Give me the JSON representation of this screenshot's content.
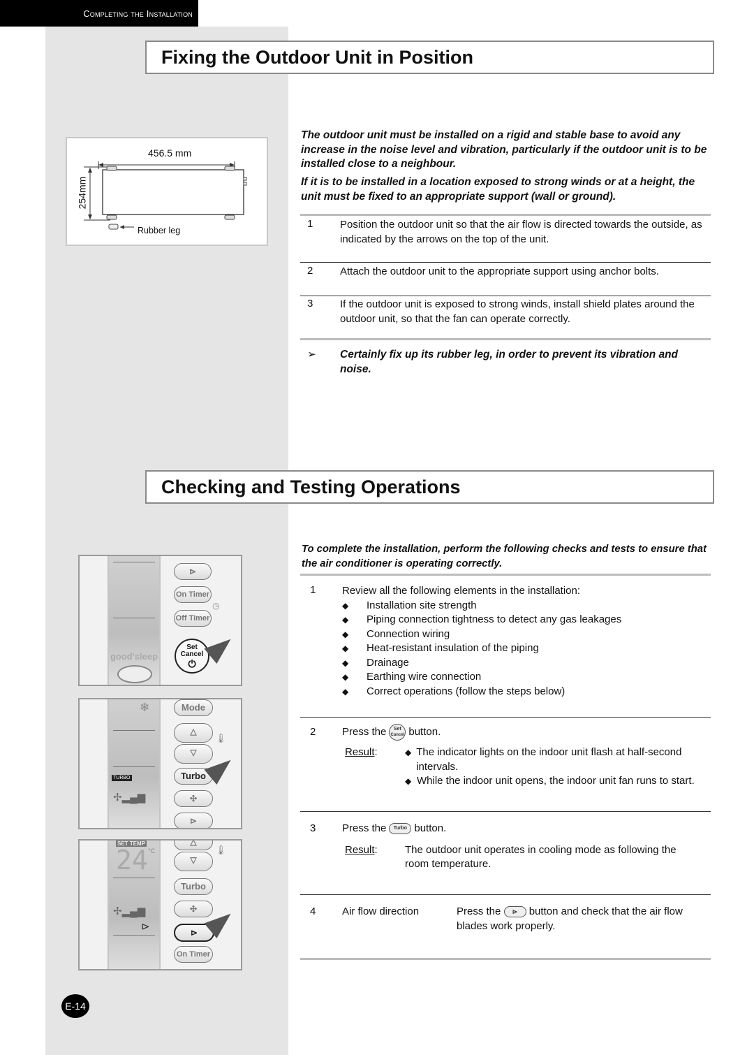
{
  "header": {
    "section": "Completing the Installation"
  },
  "section1": {
    "title": "Fixing the Outdoor Unit in Position",
    "diagram": {
      "width_label": "456.5 mm",
      "height_label": "254mm",
      "rubber_leg_label": "Rubber leg"
    },
    "intro_1": "The outdoor unit must be installed on a rigid and stable base to avoid any increase in the noise level and vibration, particularly if the outdoor unit is to be installed close to a neighbour.",
    "intro_2": "If it is to be installed in a location exposed to strong winds or at a height, the unit must be fixed to an appropriate support (wall or ground).",
    "steps": [
      {
        "num": "1",
        "text": "Position the outdoor unit so that the air flow is directed towards the outside, as indicated by the arrows on the top of the unit."
      },
      {
        "num": "2",
        "text": "Attach the outdoor unit to the appropriate support using anchor bolts."
      },
      {
        "num": "3",
        "text": "If the outdoor unit is exposed to strong winds, install shield plates around the outdoor unit, so that the fan can operate correctly."
      }
    ],
    "note_icon": "➢",
    "note": "Certainly fix up its rubber leg, in order to prevent its vibration and noise."
  },
  "section2": {
    "title": "Checking and Testing Operations",
    "intro": "To complete the installation, perform the following checks and tests to ensure that the air conditioner is operating correctly.",
    "step1": {
      "num": "1",
      "text": "Review all the following elements in the installation:",
      "bullet": "◆",
      "items": [
        "Installation site strength",
        "Piping connection tightness to detect any gas leakages",
        "Connection wiring",
        "Heat-resistant insulation of the piping",
        "Drainage",
        "Earthing wire connection",
        "Correct operations (follow the steps below)"
      ]
    },
    "step2": {
      "num": "2",
      "press_prefix": "Press the",
      "button_top": "Set",
      "button_mid": "Cancel",
      "press_suffix": "button.",
      "result_label": "Result",
      "results": [
        "The indicator lights on the indoor unit flash at half-second intervals.",
        "While the indoor unit opens, the indoor unit fan runs to start."
      ]
    },
    "step3": {
      "num": "3",
      "press_prefix": "Press the",
      "button_label": "Turbo",
      "press_suffix": "button.",
      "result_label": "Result",
      "result": "The outdoor unit operates in cooling mode as following the room temperature."
    },
    "step4": {
      "num": "4",
      "label": "Air flow direction",
      "press_prefix": "Press the",
      "press_suffix": "button and check that the air flow blades work properly."
    },
    "remote": {
      "on_timer": "On Timer",
      "off_timer": "Off Timer",
      "set": "Set",
      "cancel": "Cancel",
      "brand": "good'sleep",
      "mode": "Mode",
      "turbo": "Turbo",
      "turbo_indicator": "TURBO",
      "set_temp": "SET TEMP",
      "temp_value": "24",
      "temp_unit": "°C"
    }
  },
  "footer": {
    "page": "E-14"
  }
}
